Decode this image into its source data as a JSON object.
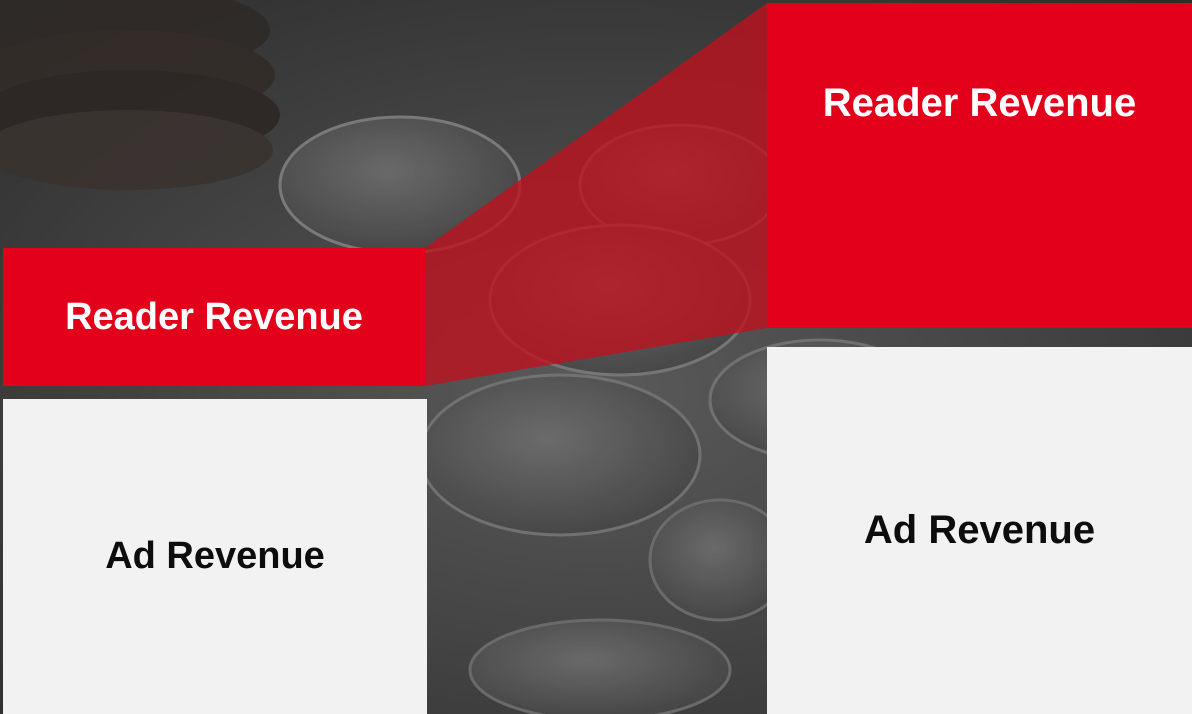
{
  "left_stack": {
    "reader_label": "Reader Revenue",
    "ad_label": "Ad Revenue"
  },
  "right_stack": {
    "reader_label": "Reader Revenue",
    "ad_label": "Ad Revenue"
  },
  "colors": {
    "reader_fill": "#e2001a",
    "ad_fill": "#f2f2f2",
    "connector_fill": "#c0101e",
    "background": "#3a3a3a"
  },
  "background_image": "coins-icon"
}
